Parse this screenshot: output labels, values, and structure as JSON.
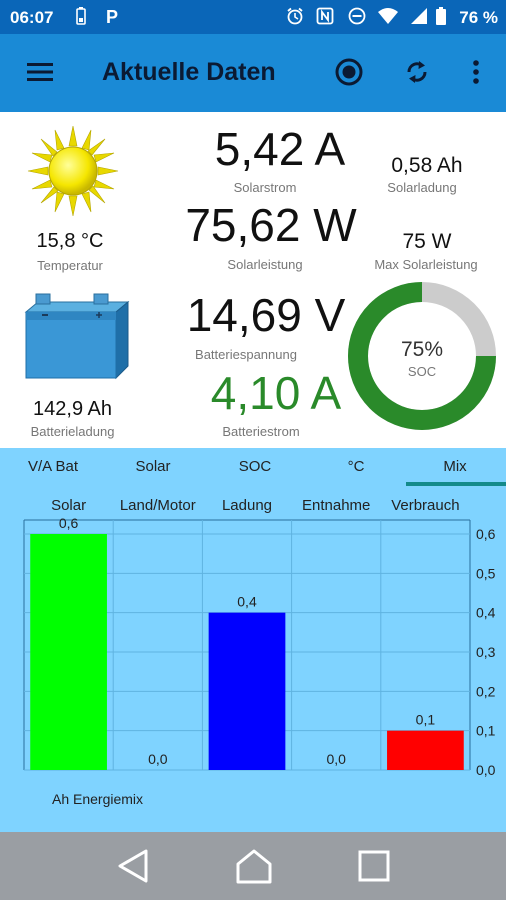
{
  "status_bar": {
    "time": "06:07",
    "battery": "76 %"
  },
  "app_bar": {
    "title": "Aktuelle Daten",
    "menu_icon": "hamburger-menu-icon",
    "record_icon": "record-icon",
    "refresh_icon": "refresh-icon",
    "overflow_icon": "overflow-menu-icon"
  },
  "readings": {
    "solar_current": {
      "value": "5,42 A",
      "label": "Solarstrom"
    },
    "solar_charge": {
      "value": "0,58 Ah",
      "label": "Solarladung"
    },
    "temperature": {
      "value": "15,8 °C",
      "label": "Temperatur"
    },
    "solar_power": {
      "value": "75,62 W",
      "label": "Solarleistung"
    },
    "max_solar_power": {
      "value": "75 W",
      "label": "Max Solarleistung"
    },
    "battery_charge": {
      "value": "142,9 Ah",
      "label": "Batterieladung"
    },
    "battery_voltage": {
      "value": "14,69 V",
      "label": "Batteriespannung"
    },
    "battery_current": {
      "value": "4,10 A",
      "label": "Batteriestrom"
    },
    "soc": {
      "value": "75%",
      "label": "SOC",
      "fraction": 0.75
    }
  },
  "tabs": [
    {
      "label": "V/A Bat"
    },
    {
      "label": "Solar"
    },
    {
      "label": "SOC"
    },
    {
      "label": "°C"
    },
    {
      "label": "Mix"
    }
  ],
  "active_tab": "Mix",
  "chart_data": {
    "type": "bar",
    "categories": [
      "Solar",
      "Land/Motor",
      "Ladung",
      "Entnahme",
      "Verbrauch"
    ],
    "values": [
      0.6,
      0.0,
      0.4,
      0.0,
      0.1
    ],
    "value_labels": [
      "0,6",
      "0,0",
      "0,4",
      "0,0",
      "0,1"
    ],
    "colors": [
      "#00ff00",
      "#888888",
      "#0000ff",
      "#888888",
      "#ff0000"
    ],
    "ylim": [
      0,
      0.6
    ],
    "ytick_labels": [
      "0,6",
      "0,5",
      "0,4",
      "0,3",
      "0,2",
      "0,1",
      "0,0"
    ],
    "ytick_values": [
      0.6,
      0.5,
      0.4,
      0.3,
      0.2,
      0.1,
      0.0
    ],
    "y_axis_side": "right",
    "grid": true,
    "legend": "Ah Energiemix"
  },
  "colors": {
    "status_bar": "#0a66b8",
    "app_bar": "#1a8ad6",
    "accent_green": "#2a8a2a",
    "chart_bg": "#7fd3ff"
  }
}
